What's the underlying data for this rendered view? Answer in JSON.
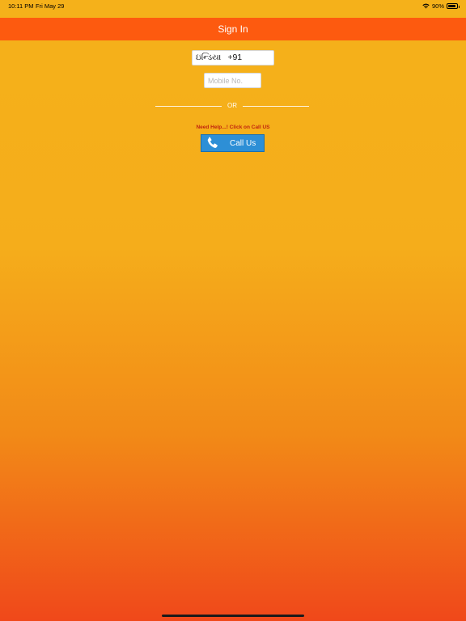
{
  "status_bar": {
    "time": "10:11 PM",
    "date": "Fri May 29",
    "battery": "90%"
  },
  "nav": {
    "title": "Sign In"
  },
  "form": {
    "country_name": "ઇન્ડિયા",
    "country_code": "+91",
    "mobile_placeholder": "Mobile No.",
    "mobile_value": ""
  },
  "divider": {
    "text": "OR"
  },
  "help": {
    "text": "Need Help...! Click on Call US",
    "call_label": "Call Us"
  },
  "colors": {
    "nav_bar": "#fd5a0f",
    "background_top": "#f5b11a",
    "background_bottom": "#f0481a",
    "call_button": "#2d8fd6",
    "help_text": "#c1240e"
  },
  "icons": {
    "wifi": "wifi-icon",
    "battery": "battery-icon",
    "phone": "phone-icon"
  }
}
